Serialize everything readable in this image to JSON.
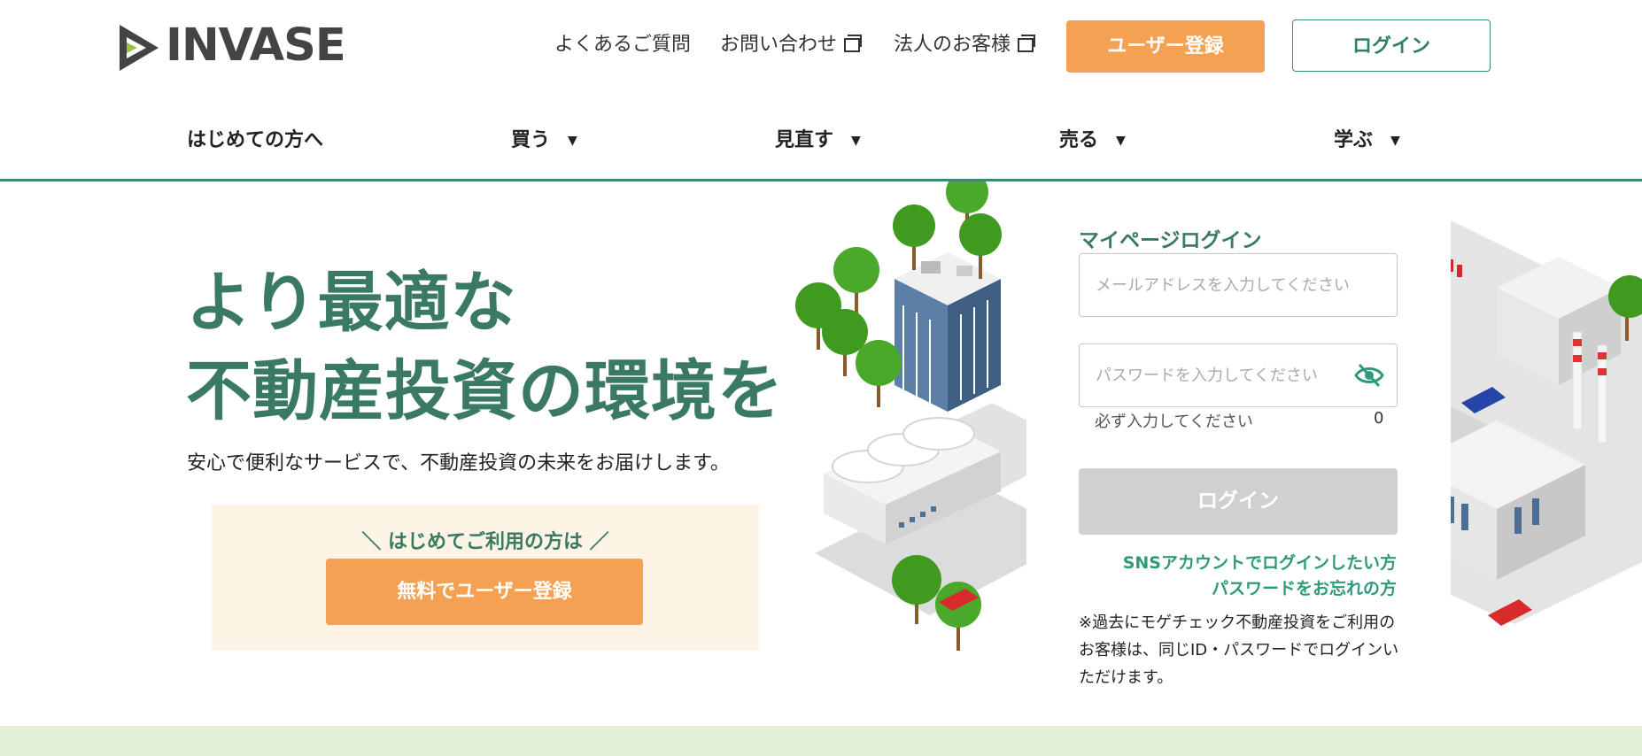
{
  "header": {
    "logo_text": "INVASE",
    "links": [
      {
        "label": "よくあるご質問"
      },
      {
        "label": "お問い合わせ"
      },
      {
        "label": "法人のお客様"
      }
    ],
    "register_label": "ユーザー登録",
    "login_label": "ログイン"
  },
  "nav": {
    "items": [
      {
        "label": "はじめての方へ"
      },
      {
        "label": "買う"
      },
      {
        "label": "見直す"
      },
      {
        "label": "売る"
      },
      {
        "label": "学ぶ"
      }
    ]
  },
  "hero": {
    "title_line1": "より最適な",
    "title_line2": "不動産投資の環境を",
    "subtitle": "安心で便利なサービスで、不動産投資の未来をお届けします。",
    "cta_note": "＼ はじめてご利用の方は ／",
    "cta_button": "無料でユーザー登録"
  },
  "login": {
    "title": "マイページログイン",
    "email_placeholder": "メールアドレスを入力してください",
    "password_placeholder": "パスワードを入力してください",
    "required_note": "必ず入力してください",
    "char_count": "0",
    "login_button": "ログイン",
    "sns_link": "SNSアカウントでログインしたい方",
    "forgot_link": "パスワードをお忘れの方",
    "notice": "※過去にモゲチェック不動産投資をご利用のお客様は、同じID・パスワードでログインいただけます。"
  },
  "colors": {
    "brand_green": "#3a7a63",
    "accent_orange": "#f4a153",
    "link_green": "#2f9a7a",
    "band_green": "#e3efd8"
  }
}
